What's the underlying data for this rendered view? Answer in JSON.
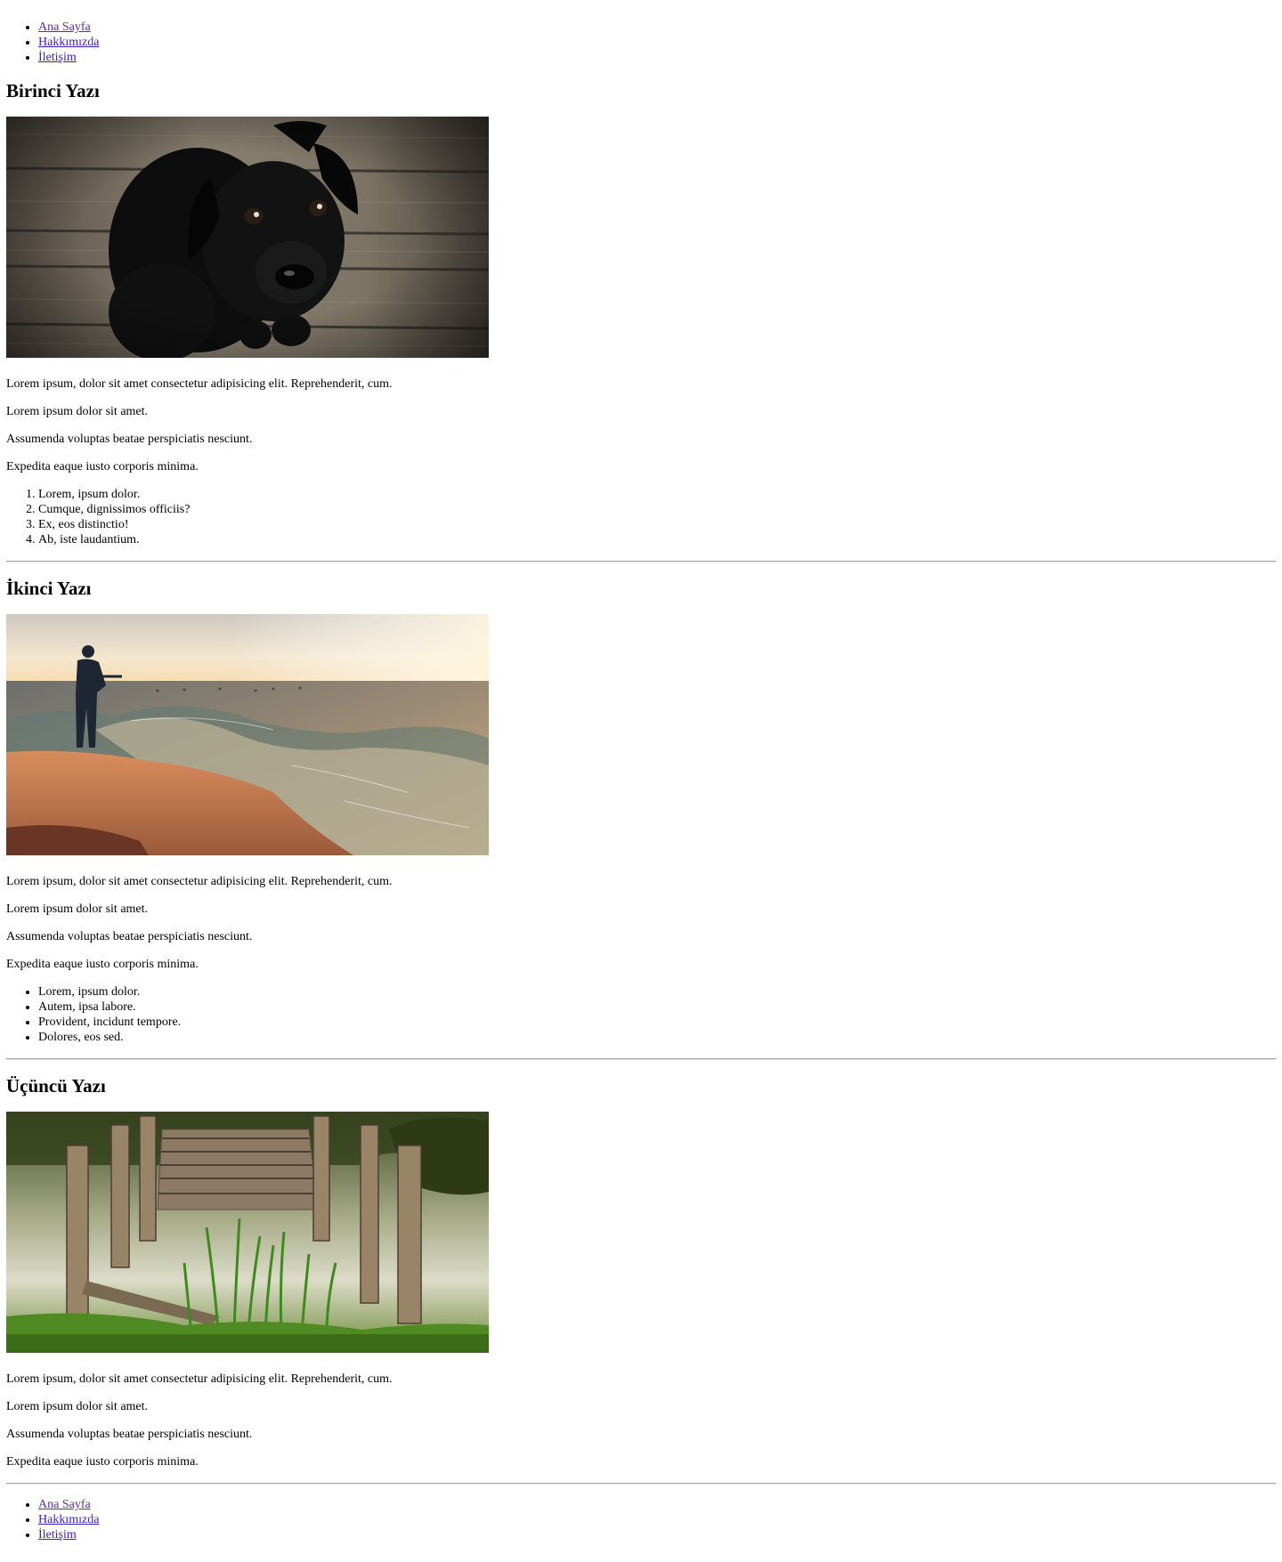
{
  "nav_top": [
    {
      "label": "Ana Sayfa"
    },
    {
      "label": "Hakkımızda"
    },
    {
      "label": "İletişim"
    }
  ],
  "posts": [
    {
      "title": "Birinci Yazı",
      "image": "black-puppy-on-wooden-floor",
      "paragraphs": [
        "Lorem ipsum, dolor sit amet consectetur adipisicing elit. Reprehenderit, cum.",
        "Lorem ipsum dolor sit amet.",
        "Assumenda voluptas beatae perspiciatis nesciunt.",
        "Expedita eaque iusto corporis minima."
      ],
      "list_type": "ordered",
      "list": [
        "Lorem, ipsum dolor.",
        "Cumque, dignissimos officiis?",
        "Ex, eos distinctio!",
        "Ab, iste laudantium."
      ]
    },
    {
      "title": "İkinci Yazı",
      "image": "fisherman-at-sunset-sea",
      "paragraphs": [
        "Lorem ipsum, dolor sit amet consectetur adipisicing elit. Reprehenderit, cum.",
        "Lorem ipsum dolor sit amet.",
        "Assumenda voluptas beatae perspiciatis nesciunt.",
        "Expedita eaque iusto corporis minima."
      ],
      "list_type": "unordered",
      "list": [
        "Lorem, ipsum dolor.",
        "Autem, ipsa labore.",
        "Provident, incidunt tempore.",
        "Dolores, eos sed."
      ]
    },
    {
      "title": "Üçüncü Yazı",
      "image": "old-wooden-pier-in-lake",
      "paragraphs": [
        "Lorem ipsum, dolor sit amet consectetur adipisicing elit. Reprehenderit, cum.",
        "Lorem ipsum dolor sit amet.",
        "Assumenda voluptas beatae perspiciatis nesciunt.",
        "Expedita eaque iusto corporis minima."
      ]
    }
  ],
  "nav_bottom": [
    {
      "label": "Ana Sayfa"
    },
    {
      "label": "Hakkımızda"
    },
    {
      "label": "İletişim"
    }
  ],
  "colors": {
    "link": "#3a1bd6",
    "visited_link": "#5a2ca0",
    "rule": "#a0a0a0"
  }
}
